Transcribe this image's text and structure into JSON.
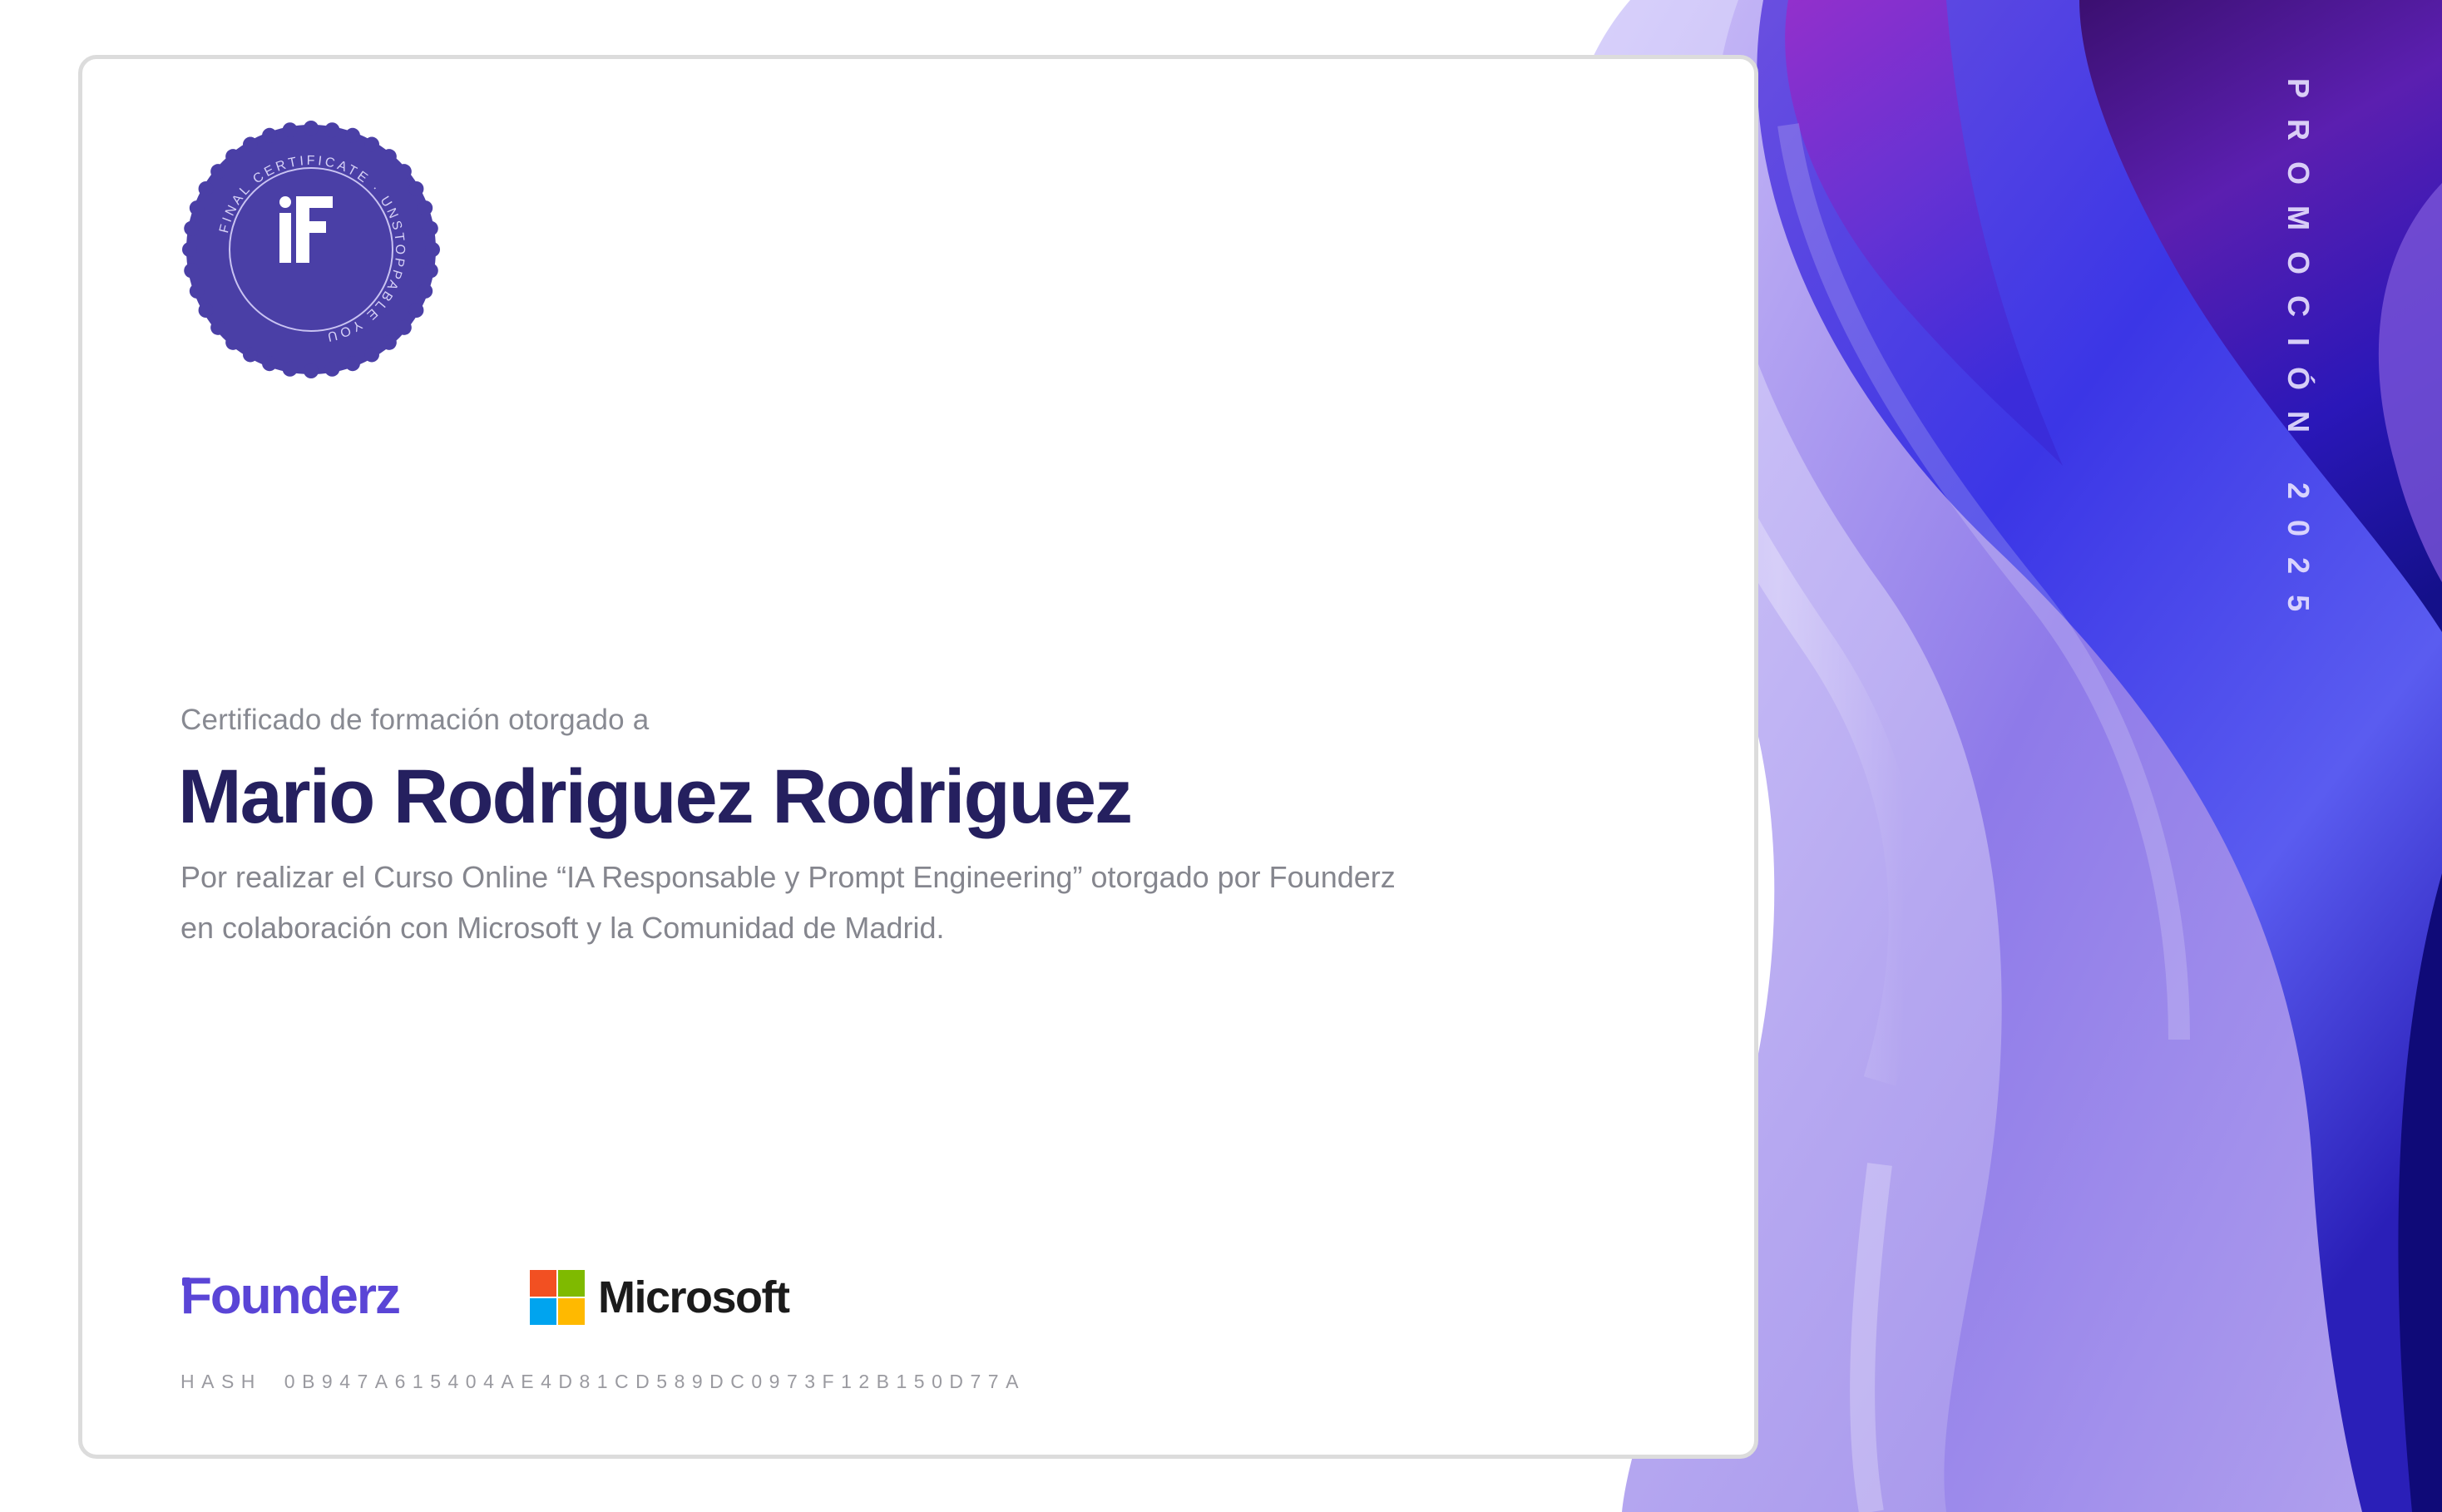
{
  "certificate": {
    "eyebrow": "Certificado de formación otorgado a",
    "recipient_name": "Mario Rodriguez Rodriguez",
    "description": "Por realizar el Curso Online “IA Responsable y Prompt Engineering” otorgado por Founderz en colaboración con Microsoft y la Comunidad de Madrid.",
    "hash_label": "HASH",
    "hash_value": "0B947A615404AE4D81CD589DC0973F12B150D77A",
    "promotion": "PROMOCIÓN 2025"
  },
  "seal": {
    "ring_text": "FINAL CERTIFICATE · UNSTOPPABLE YOU",
    "monogram": "F",
    "color": "#4a3fa6"
  },
  "logos": {
    "founderz": "Founderz",
    "microsoft": "Microsoft",
    "founderz_color": "#5a45d6",
    "microsoft_colors": [
      "#f25022",
      "#7fba00",
      "#00a4ef",
      "#ffb900"
    ]
  },
  "colors": {
    "name_color": "#25205f",
    "body_text": "#85868e",
    "wave_colors": [
      "#c9bff4",
      "#8f7be8",
      "#4a3ae0",
      "#3c1fa8",
      "#8c2bc4"
    ]
  }
}
